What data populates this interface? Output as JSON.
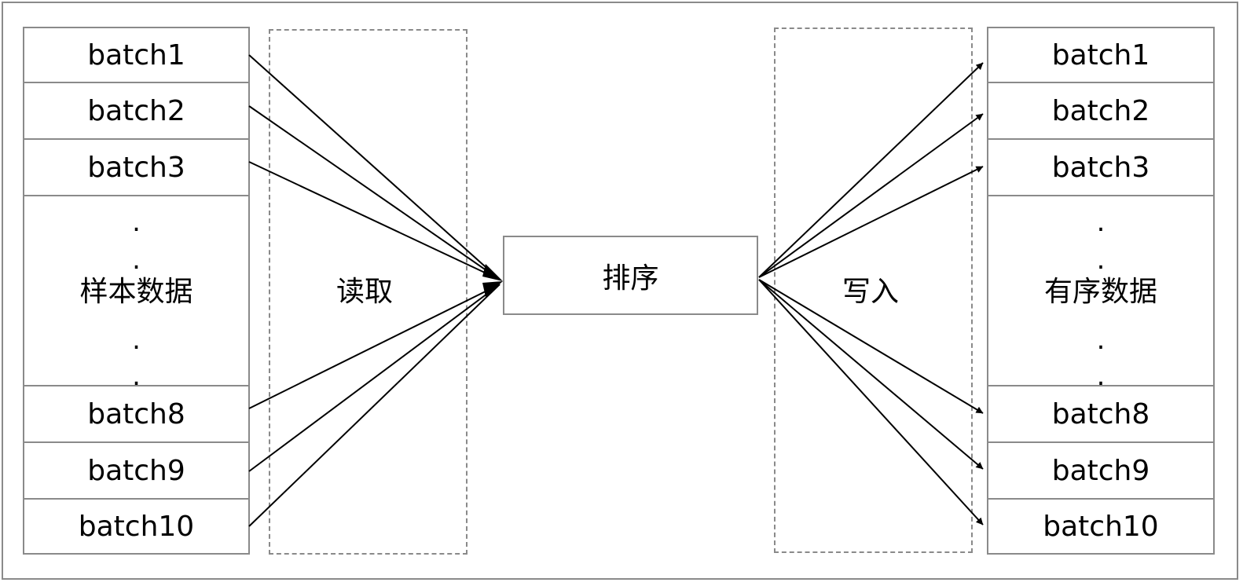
{
  "left_column": {
    "top_batches": [
      "batch1",
      "batch2",
      "batch3"
    ],
    "middle_label": "样本数据",
    "bottom_batches": [
      "batch8",
      "batch9",
      "batch10"
    ],
    "dot": "."
  },
  "read_zone": {
    "label": "读取"
  },
  "sort_box": {
    "label": "排序"
  },
  "write_zone": {
    "label": "写入"
  },
  "right_column": {
    "top_batches": [
      "batch1",
      "batch2",
      "batch3"
    ],
    "middle_label": "有序数据",
    "bottom_batches": [
      "batch8",
      "batch9",
      "batch10"
    ],
    "dot": "."
  },
  "colors": {
    "border": "#8a8a8a",
    "arrow": "#000000"
  }
}
